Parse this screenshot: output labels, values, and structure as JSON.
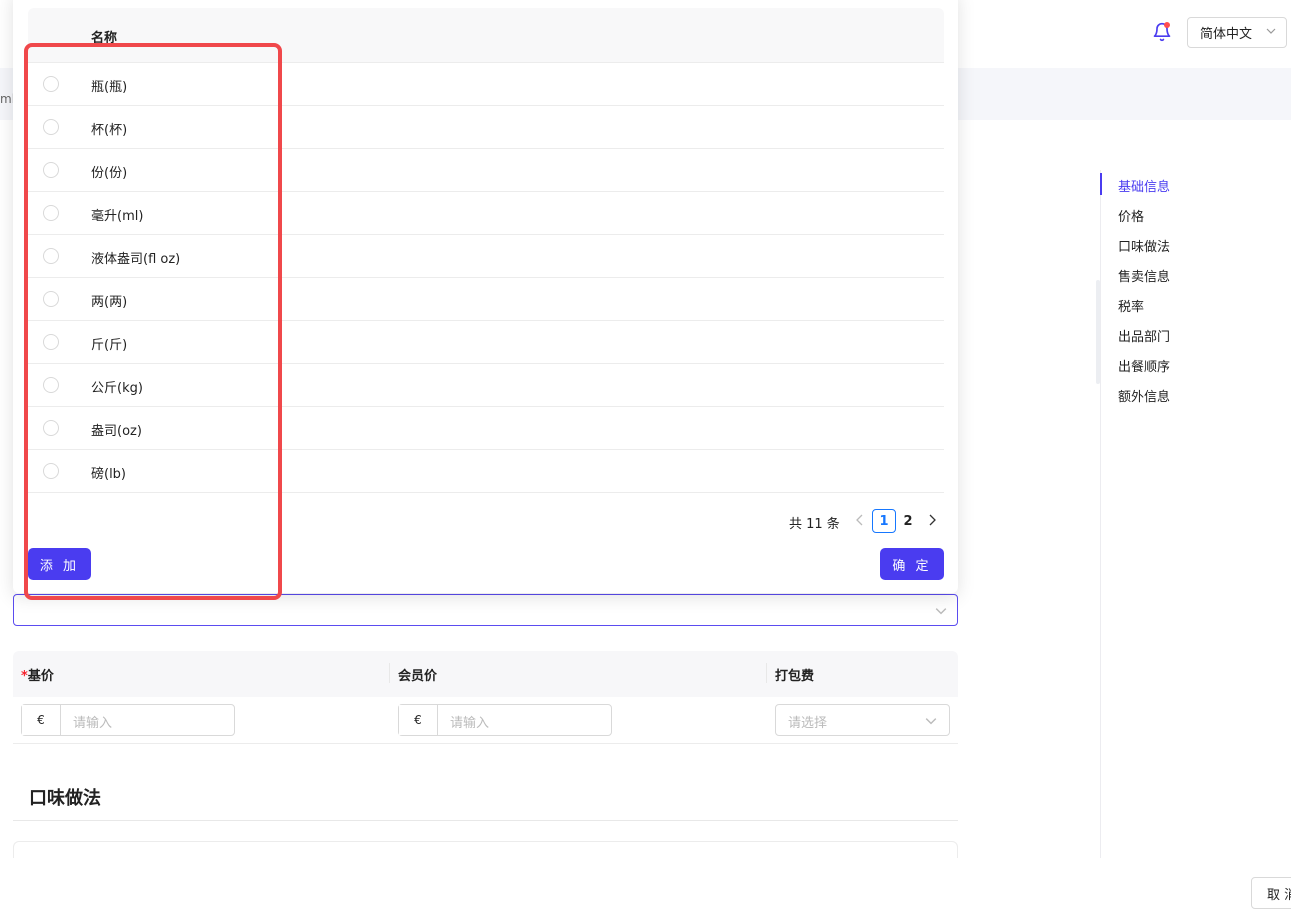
{
  "header": {
    "language": "简体中文"
  },
  "breadcrumb_fragment": "ml",
  "anchor_nav": {
    "items": [
      {
        "label": "基础信息",
        "active": true
      },
      {
        "label": "价格",
        "active": false
      },
      {
        "label": "口味做法",
        "active": false
      },
      {
        "label": "售卖信息",
        "active": false
      },
      {
        "label": "税率",
        "active": false
      },
      {
        "label": "出品部门",
        "active": false
      },
      {
        "label": "出餐顺序",
        "active": false
      },
      {
        "label": "额外信息",
        "active": false
      }
    ],
    "active_color": "#4a3cf0"
  },
  "unit_popover": {
    "column_header": "名称",
    "units": [
      "瓶(瓶)",
      "杯(杯)",
      "份(份)",
      "毫升(ml)",
      "液体盎司(fl oz)",
      "两(两)",
      "斤(斤)",
      "公斤(kg)",
      "盎司(oz)",
      "磅(lb)"
    ],
    "pagination": {
      "total_text": "共 11 条",
      "pages": [
        "1",
        "2"
      ],
      "current_page": "1"
    },
    "add_button": "添 加",
    "confirm_button": "确 定"
  },
  "price_table": {
    "base_price_required": "*",
    "base_price_label": "基价",
    "member_price_label": "会员价",
    "packing_fee_label": "打包费",
    "currency_symbol": "€",
    "input_placeholder": "请输入",
    "select_placeholder": "请选择"
  },
  "flavor_section": {
    "title": "口味做法"
  },
  "footer": {
    "cancel_label": "取 消"
  },
  "colors": {
    "primary": "#4a3cf0",
    "highlight": "#f0484b",
    "pagination_active": "#1677ff"
  }
}
